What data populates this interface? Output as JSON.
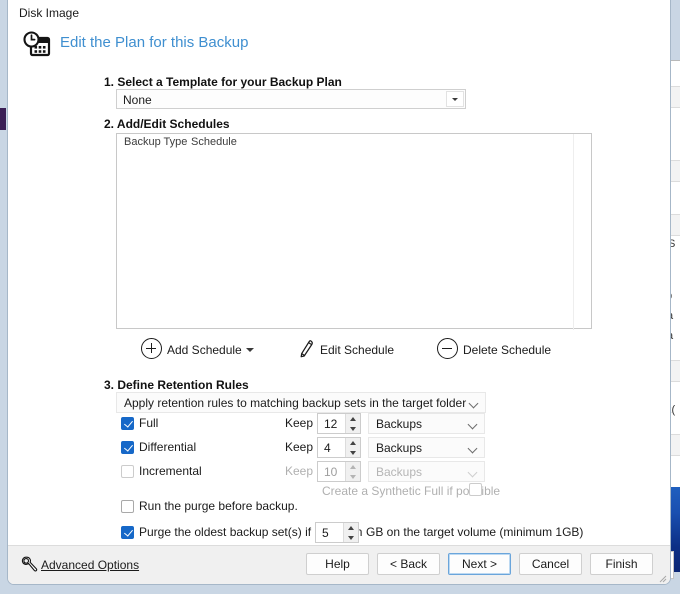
{
  "window": {
    "title": "Disk Image",
    "header_title": "Edit the Plan for this Backup",
    "header_icon": "clock-calendar-icon",
    "accent_color": "#3f8fd0",
    "checkbox_color": "#1668c8"
  },
  "step1": {
    "title": "1. Select a Template for your Backup Plan",
    "template_value": "None",
    "template_placeholder": "None"
  },
  "step2": {
    "title": "2. Add/Edit Schedules",
    "columns": [
      "Backup Type",
      "Schedule"
    ],
    "rows": [],
    "actions": [
      {
        "label": "Add Schedule",
        "icon": "plus-circle-icon",
        "has_dropdown": true
      },
      {
        "label": "Edit Schedule",
        "icon": "pencil-icon",
        "has_dropdown": false
      },
      {
        "label": "Delete Schedule",
        "icon": "minus-circle-icon",
        "has_dropdown": false
      }
    ]
  },
  "step3": {
    "title": "3. Define Retention Rules",
    "scope_value": "Apply retention rules to matching backup sets in the target folder",
    "keep_label": "Keep",
    "rules": [
      {
        "name": "Full",
        "checked": true,
        "enabled": true,
        "keep": "12",
        "unit": "Backups"
      },
      {
        "name": "Differential",
        "checked": true,
        "enabled": true,
        "keep": "4",
        "unit": "Backups"
      },
      {
        "name": "Incremental",
        "checked": false,
        "enabled": false,
        "keep": "10",
        "unit": "Backups"
      }
    ],
    "synthetic_full_label": "Create a Synthetic Full if possible",
    "synthetic_full_checked": false,
    "purge_before_label": "Run the purge before backup.",
    "purge_before_checked": false,
    "purge_oldest_label": "Purge the oldest backup set(s) if less than",
    "purge_oldest_checked": true,
    "purge_oldest_value": "5",
    "purge_oldest_suffix": "GB on the target volume (minimum 1GB)"
  },
  "footer": {
    "advanced_options": "Advanced Options",
    "advanced_icon": "wrench-icon",
    "buttons": [
      {
        "label": "Help",
        "primary": false
      },
      {
        "label": "< Back",
        "primary": false
      },
      {
        "label": "Next >",
        "primary": true
      },
      {
        "label": "Cancel",
        "primary": false
      },
      {
        "label": "Finish",
        "primary": false
      }
    ]
  },
  "background": {
    "fragments": [
      "S",
      "p",
      "a",
      "a",
      "x("
    ],
    "desktop_color": "#c9d6e4"
  }
}
